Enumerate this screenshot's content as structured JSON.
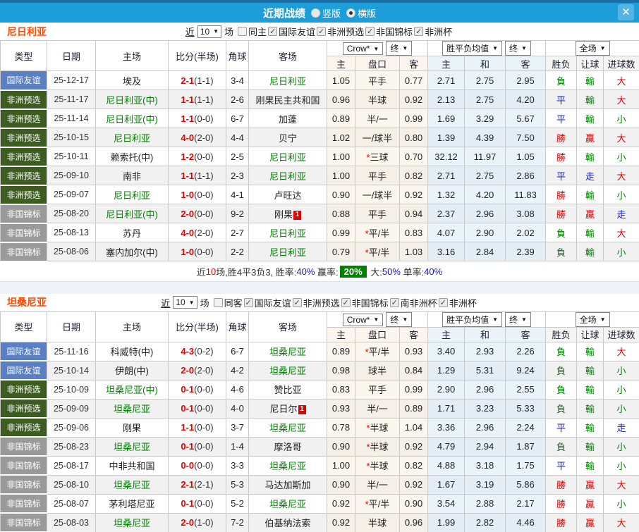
{
  "titlebar": {
    "title": "近期战绩",
    "radio_vertical": "竖版",
    "radio_horizontal": "横版",
    "selected_layout": "横版",
    "close_icon": "✕",
    "bar_color": "#1e9ed9"
  },
  "filter_labels": {
    "near": "近",
    "games": "场"
  },
  "table_header": {
    "col_type": "类型",
    "col_date": "日期",
    "col_home": "主场",
    "col_score": "比分(半场)",
    "col_corner": "角球",
    "col_away": "客场",
    "dd_company": "Crow*",
    "dd_final1": "终",
    "dd_mean": "胜平负均值",
    "dd_final2": "终",
    "dd_fulltime": "全场",
    "sub_home": "主",
    "sub_handicap": "盘口",
    "sub_away": "客",
    "sub_m_home": "主",
    "sub_m_draw": "和",
    "sub_m_away": "客",
    "sub_wl": "胜负",
    "sub_hcp": "让球",
    "sub_goals": "进球数"
  },
  "layout_col_widths": [
    66,
    69,
    103,
    82,
    32,
    111,
    40,
    63,
    40,
    52,
    58,
    57,
    44,
    38,
    51
  ],
  "colors": {
    "type_colors": {
      "国际友谊": "#5a7fc3",
      "非洲预选": "#3c5c20",
      "非国锦标": "#9a9a9a"
    },
    "result_map": {
      "勝": "#e00000",
      "贏": "#e00000",
      "大": "#e00000",
      "負": "#008000",
      "輸": "#008000",
      "小": "#008000",
      "平": "#1414cc",
      "走": "#1414cc"
    },
    "team_green": "#008000",
    "score_red": "#e00000",
    "pct_blue": "#1414cc",
    "win_rate_box_bg": "#008000"
  },
  "row_fields": [
    "type",
    "date",
    "home",
    "home_green",
    "home_badge",
    "score",
    "half",
    "corner",
    "away",
    "away_green",
    "away_badge",
    "odds_home",
    "handicap",
    "odds_away",
    "mean_home",
    "mean_draw",
    "mean_away",
    "res_wl",
    "res_hcp",
    "res_goal"
  ],
  "sections": [
    {
      "team": "尼日利亚",
      "filter": {
        "count": "10",
        "same_label": "同主",
        "same_checked": false,
        "leagues": [
          {
            "label": "国际友谊",
            "checked": true
          },
          {
            "label": "非洲预选",
            "checked": true
          },
          {
            "label": "非国锦标",
            "checked": true
          },
          {
            "label": "非洲杯",
            "checked": true
          }
        ]
      },
      "rows": [
        [
          "国际友谊",
          "25-12-17",
          "埃及",
          0,
          "",
          "2-1",
          "(1-1)",
          "3-4",
          "尼日利亚",
          1,
          "",
          "1.05",
          "平手",
          "0.77",
          "2.71",
          "2.75",
          "2.95",
          "負",
          "輸",
          "大"
        ],
        [
          "非洲预选",
          "25-11-17",
          "尼日利亚(中)",
          1,
          "",
          "1-1",
          "(1-1)",
          "2-6",
          "刚果民主共和国",
          0,
          "",
          "0.96",
          "半球",
          "0.92",
          "2.13",
          "2.75",
          "4.20",
          "平",
          "輸",
          "大"
        ],
        [
          "非洲预选",
          "25-11-14",
          "尼日利亚(中)",
          1,
          "",
          "1-1",
          "(0-0)",
          "6-7",
          "加蓬",
          0,
          "",
          "0.89",
          "半/一",
          "0.99",
          "1.69",
          "3.29",
          "5.67",
          "平",
          "輸",
          "小"
        ],
        [
          "非洲预选",
          "25-10-15",
          "尼日利亚",
          1,
          "",
          "4-0",
          "(2-0)",
          "4-4",
          "贝宁",
          0,
          "",
          "1.02",
          "一/球半",
          "0.80",
          "1.39",
          "4.39",
          "7.50",
          "勝",
          "贏",
          "大"
        ],
        [
          "非洲预选",
          "25-10-11",
          "赖索托(中)",
          0,
          "",
          "1-2",
          "(0-0)",
          "2-5",
          "尼日利亚",
          1,
          "",
          "1.00",
          "*三球",
          "0.70",
          "32.12",
          "11.97",
          "1.05",
          "勝",
          "輸",
          "小"
        ],
        [
          "非洲预选",
          "25-09-10",
          "南非",
          0,
          "",
          "1-1",
          "(1-1)",
          "2-3",
          "尼日利亚",
          1,
          "",
          "1.00",
          "平手",
          "0.82",
          "2.71",
          "2.75",
          "2.86",
          "平",
          "走",
          "大"
        ],
        [
          "非洲预选",
          "25-09-07",
          "尼日利亚",
          1,
          "",
          "1-0",
          "(0-0)",
          "4-1",
          "卢旺达",
          0,
          "",
          "0.90",
          "一/球半",
          "0.92",
          "1.32",
          "4.20",
          "11.83",
          "勝",
          "輸",
          "小"
        ],
        [
          "非国锦标",
          "25-08-20",
          "尼日利亚(中)",
          1,
          "",
          "2-0",
          "(0-0)",
          "9-2",
          "刚果",
          0,
          "1",
          "0.88",
          "平手",
          "0.94",
          "2.37",
          "2.96",
          "3.08",
          "勝",
          "贏",
          "走"
        ],
        [
          "非国锦标",
          "25-08-13",
          "苏丹",
          0,
          "",
          "4-0",
          "(2-0)",
          "2-7",
          "尼日利亚",
          1,
          "",
          "0.99",
          "*平/半",
          "0.83",
          "4.07",
          "2.90",
          "2.02",
          "負",
          "輸",
          "大"
        ],
        [
          "非国锦标",
          "25-08-06",
          "塞内加尔(中)",
          0,
          "",
          "1-0",
          "(0-0)",
          "2-2",
          "尼日利亚",
          1,
          "",
          "0.79",
          "*平/半",
          "1.03",
          "3.16",
          "2.84",
          "2.39",
          "負",
          "輸",
          "小"
        ]
      ],
      "summary": [
        {
          "t": "近",
          "c": "#333"
        },
        {
          "t": "10",
          "c": "#e00000"
        },
        {
          "t": "场,胜4平3负3, 胜率:",
          "c": "#333"
        },
        {
          "t": "40%",
          "c": "#1414cc"
        },
        {
          "t": " 赢率:",
          "c": "#333"
        },
        {
          "t": "20%",
          "c": "#ffffff",
          "bg": "#008000"
        },
        {
          "t": " 大:",
          "c": "#333"
        },
        {
          "t": "50%",
          "c": "#1414cc"
        },
        {
          "t": " 单率:",
          "c": "#333"
        },
        {
          "t": "40%",
          "c": "#1414cc"
        }
      ]
    },
    {
      "team": "坦桑尼亚",
      "filter": {
        "count": "10",
        "same_label": "同客",
        "same_checked": false,
        "leagues": [
          {
            "label": "国际友谊",
            "checked": true
          },
          {
            "label": "非洲预选",
            "checked": true
          },
          {
            "label": "非国锦标",
            "checked": true
          },
          {
            "label": "南非洲杯",
            "checked": true
          },
          {
            "label": "非洲杯",
            "checked": true
          }
        ]
      },
      "rows": [
        [
          "国际友谊",
          "25-11-16",
          "科威特(中)",
          0,
          "",
          "4-3",
          "(0-2)",
          "6-7",
          "坦桑尼亚",
          1,
          "",
          "0.89",
          "*平/半",
          "0.93",
          "3.40",
          "2.93",
          "2.26",
          "負",
          "輸",
          "大"
        ],
        [
          "国际友谊",
          "25-10-14",
          "伊朗(中)",
          0,
          "",
          "2-0",
          "(2-0)",
          "4-2",
          "坦桑尼亚",
          1,
          "",
          "0.98",
          "球半",
          "0.84",
          "1.29",
          "5.31",
          "9.24",
          "負",
          "輸",
          "小"
        ],
        [
          "非洲预选",
          "25-10-09",
          "坦桑尼亚(中)",
          1,
          "",
          "0-1",
          "(0-0)",
          "4-6",
          "赞比亚",
          0,
          "",
          "0.83",
          "平手",
          "0.99",
          "2.90",
          "2.96",
          "2.55",
          "負",
          "輸",
          "小"
        ],
        [
          "非洲预选",
          "25-09-09",
          "坦桑尼亚",
          1,
          "",
          "0-1",
          "(0-0)",
          "4-0",
          "尼日尔",
          0,
          "1",
          "0.93",
          "半/一",
          "0.89",
          "1.71",
          "3.23",
          "5.33",
          "負",
          "輸",
          "小"
        ],
        [
          "非洲预选",
          "25-09-06",
          "刚果",
          0,
          "",
          "1-1",
          "(0-0)",
          "3-7",
          "坦桑尼亚",
          1,
          "",
          "0.78",
          "*半球",
          "1.04",
          "3.36",
          "2.96",
          "2.24",
          "平",
          "輸",
          "走"
        ],
        [
          "非国锦标",
          "25-08-23",
          "坦桑尼亚",
          1,
          "",
          "0-1",
          "(0-0)",
          "1-4",
          "摩洛哥",
          0,
          "",
          "0.90",
          "*半球",
          "0.92",
          "4.79",
          "2.94",
          "1.87",
          "負",
          "輸",
          "小"
        ],
        [
          "非国锦标",
          "25-08-17",
          "中非共和国",
          0,
          "",
          "0-0",
          "(0-0)",
          "3-3",
          "坦桑尼亚",
          1,
          "",
          "1.00",
          "*半球",
          "0.82",
          "4.88",
          "3.18",
          "1.75",
          "平",
          "輸",
          "小"
        ],
        [
          "非国锦标",
          "25-08-10",
          "坦桑尼亚",
          1,
          "",
          "2-1",
          "(2-1)",
          "5-3",
          "马达加斯加",
          0,
          "",
          "0.90",
          "半/一",
          "0.92",
          "1.67",
          "3.19",
          "5.86",
          "勝",
          "贏",
          "大"
        ],
        [
          "非国锦标",
          "25-08-07",
          "茅利塔尼亚",
          0,
          "",
          "0-1",
          "(0-0)",
          "5-2",
          "坦桑尼亚",
          1,
          "",
          "0.92",
          "*平/半",
          "0.90",
          "3.54",
          "2.88",
          "2.17",
          "勝",
          "贏",
          "小"
        ],
        [
          "非国锦标",
          "25-08-03",
          "坦桑尼亚",
          1,
          "",
          "2-0",
          "(1-0)",
          "7-2",
          "伯基纳法索",
          0,
          "",
          "0.92",
          "半球",
          "0.96",
          "1.99",
          "2.82",
          "4.46",
          "勝",
          "贏",
          "大"
        ]
      ],
      "summary": null
    }
  ]
}
